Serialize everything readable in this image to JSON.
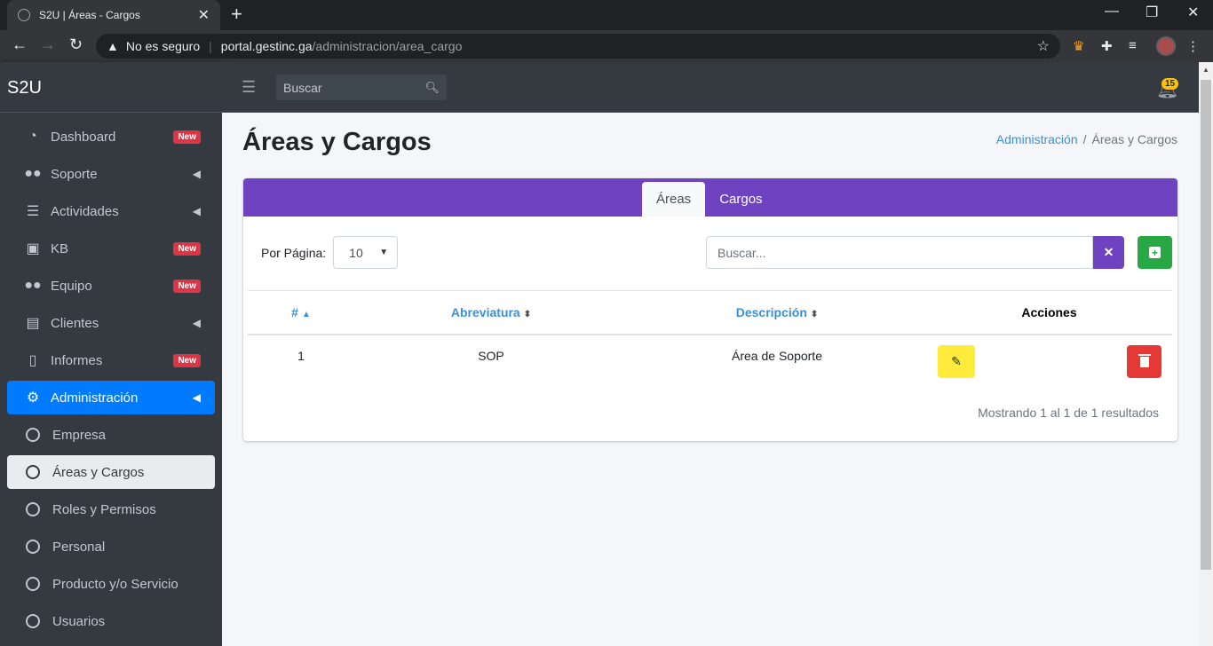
{
  "browser": {
    "tab_title": "S2U | Áreas - Cargos",
    "security_label": "No es seguro",
    "url_host": "portal.gestinc.ga",
    "url_path": "/administracion/area_cargo"
  },
  "brand": "S2U",
  "sidebar": {
    "items": [
      {
        "label": "Dashboard",
        "icon": "dashboard-icon",
        "badge": "New"
      },
      {
        "label": "Soporte",
        "icon": "users-icon"
      },
      {
        "label": "Actividades",
        "icon": "tasks-icon"
      },
      {
        "label": "KB",
        "icon": "book-icon",
        "badge": "New"
      },
      {
        "label": "Equipo",
        "icon": "users-icon",
        "badge": "New"
      },
      {
        "label": "Clientes",
        "icon": "contact-book-icon"
      },
      {
        "label": "Informes",
        "icon": "document-icon",
        "badge": "New"
      },
      {
        "label": "Administración",
        "icon": "gear-icon"
      }
    ],
    "subitems": [
      {
        "label": "Empresa"
      },
      {
        "label": "Áreas y Cargos"
      },
      {
        "label": "Roles y Permisos"
      },
      {
        "label": "Personal"
      },
      {
        "label": "Producto y/o Servicio"
      },
      {
        "label": "Usuarios"
      }
    ]
  },
  "topbar": {
    "search_placeholder": "Buscar",
    "notification_count": "15"
  },
  "page": {
    "title": "Áreas y Cargos",
    "breadcrumb": [
      "Administración",
      "Áreas y Cargos"
    ]
  },
  "card": {
    "tabs": [
      "Áreas",
      "Cargos"
    ],
    "per_page_label": "Por Página:",
    "per_page_value": "10",
    "search_placeholder": "Buscar...",
    "columns": [
      "#",
      "Abreviatura",
      "Descripción",
      "Acciones"
    ],
    "rows": [
      {
        "id": "1",
        "abbr": "SOP",
        "desc": "Área de Soporte"
      }
    ],
    "footer": "Mostrando 1 al 1 de 1 resultados"
  },
  "colors": {
    "accent": "#6f42c1",
    "active_nav": "#007bff",
    "add": "#28a745",
    "edit": "#ffeb3b",
    "delete": "#e53935"
  }
}
